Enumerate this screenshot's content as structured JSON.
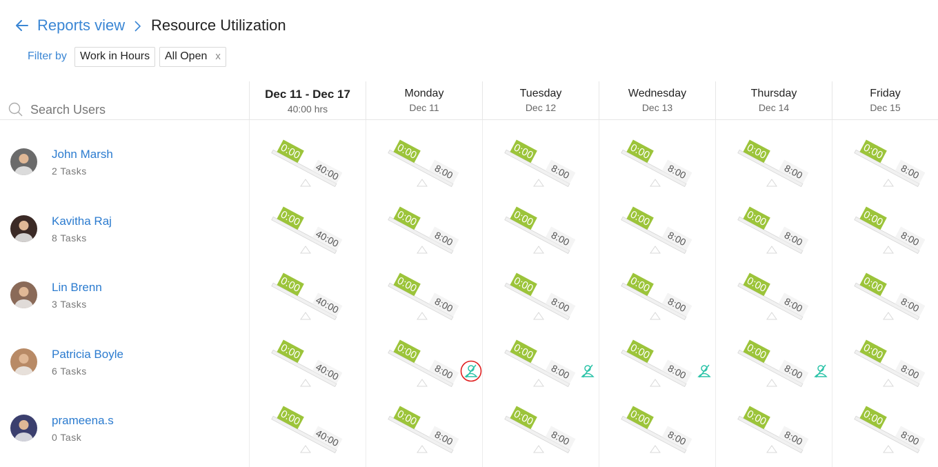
{
  "breadcrumb": {
    "back_label": "Reports view",
    "current": "Resource Utilization"
  },
  "filter": {
    "label": "Filter by",
    "chips": [
      {
        "label": "Work in Hours",
        "closable": false
      },
      {
        "label": "All Open",
        "closable": true,
        "close_label": "x"
      }
    ]
  },
  "search": {
    "placeholder": "Search Users"
  },
  "columns": [
    {
      "title": "Dec 11 - Dec 17",
      "sub": "40:00 hrs"
    },
    {
      "title": "Monday",
      "sub": "Dec 11"
    },
    {
      "title": "Tuesday",
      "sub": "Dec 12"
    },
    {
      "title": "Wednesday",
      "sub": "Dec 13"
    },
    {
      "title": "Thursday",
      "sub": "Dec 14"
    },
    {
      "title": "Friday",
      "sub": "Dec 15"
    }
  ],
  "users": [
    {
      "name": "John Marsh",
      "tasks": "2 Tasks",
      "avatar_bg": "#6b6b6b"
    },
    {
      "name": "Kavitha Raj",
      "tasks": "8 Tasks",
      "avatar_bg": "#3b2a26"
    },
    {
      "name": "Lin Brenn",
      "tasks": "3 Tasks",
      "avatar_bg": "#8a6a58"
    },
    {
      "name": "Patricia Boyle",
      "tasks": "6 Tasks",
      "avatar_bg": "#b88a66"
    },
    {
      "name": "prameena.s",
      "tasks": "0 Task",
      "avatar_bg": "#3b3f6e"
    }
  ],
  "cells": {
    "logged": "0:00",
    "week_capacity": "40:00",
    "day_capacity": "8:00"
  },
  "unassigned_days": [
    {
      "user": 3,
      "day": 1,
      "highlighted": true
    },
    {
      "user": 3,
      "day": 2,
      "highlighted": false
    },
    {
      "user": 3,
      "day": 3,
      "highlighted": false
    },
    {
      "user": 3,
      "day": 4,
      "highlighted": false
    }
  ],
  "colors": {
    "accent": "#3a86d4",
    "link": "#2b7bcf",
    "logged_green": "#9cc43a",
    "unassign_teal": "#2cc3a8",
    "highlight_red": "#e02020"
  }
}
